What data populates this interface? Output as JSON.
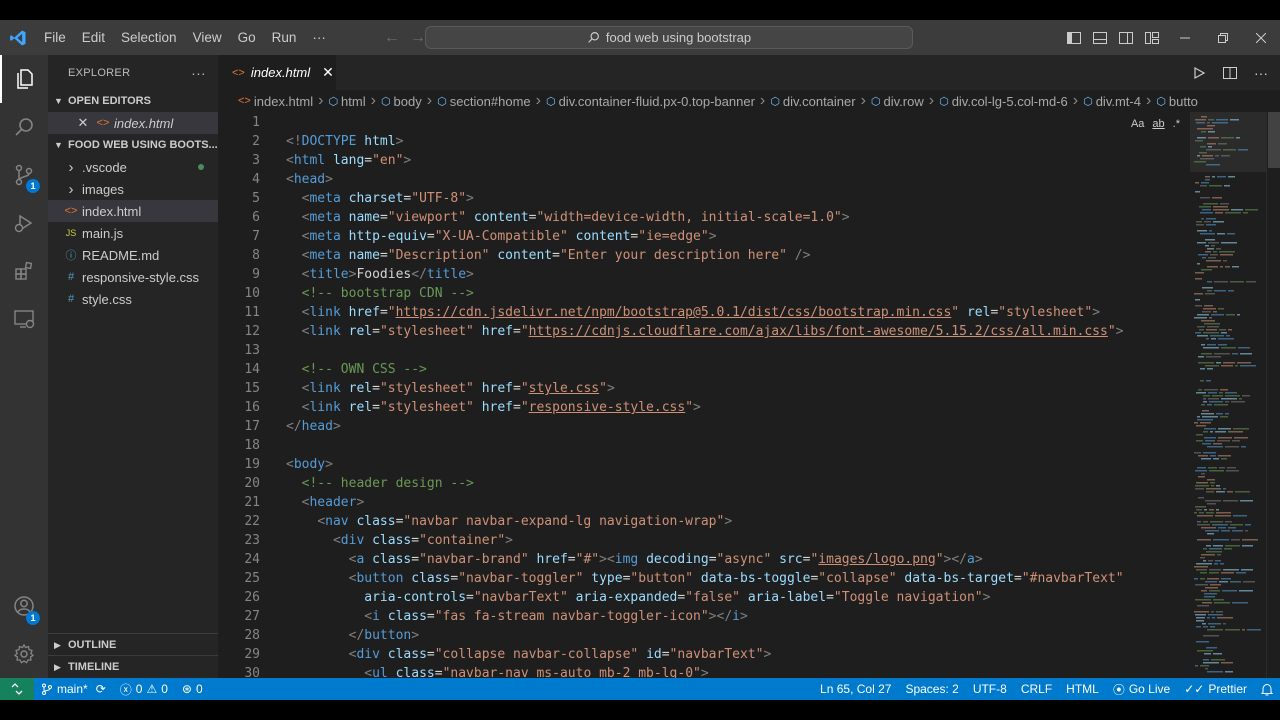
{
  "menu": [
    "File",
    "Edit",
    "Selection",
    "View",
    "Go",
    "Run",
    "···"
  ],
  "search": {
    "text": "food web using bootstrap"
  },
  "explorer": {
    "title": "EXPLORER",
    "more": "···",
    "open_editors_label": "OPEN EDITORS",
    "open_editor_file": "index.html",
    "project_label": "FOOD WEB USING BOOTS...",
    "items": [
      {
        "name": ".vscode",
        "kind": "folder"
      },
      {
        "name": "images",
        "kind": "folder"
      },
      {
        "name": "index.html",
        "kind": "html"
      },
      {
        "name": "main.js",
        "kind": "js"
      },
      {
        "name": "README.md",
        "kind": "md"
      },
      {
        "name": "responsive-style.css",
        "kind": "css"
      },
      {
        "name": "style.css",
        "kind": "css"
      }
    ],
    "outline_label": "OUTLINE",
    "timeline_label": "TIMELINE"
  },
  "tab": {
    "label": "index.html"
  },
  "breadcrumb": [
    "index.html",
    "html",
    "body",
    "section#home",
    "div.container-fluid.px-0.top-banner",
    "div.container",
    "div.row",
    "div.col-lg-5.col-md-6",
    "div.mt-4",
    "butto"
  ],
  "find_widget": {
    "case": "Aa",
    "word": "ab",
    "regex": ".*"
  },
  "badges": {
    "source_control": "1",
    "accounts": "1"
  },
  "code_lines": [
    {
      "n": "1",
      "tokens": []
    },
    {
      "n": "2",
      "tokens": [
        [
          "br",
          "<!"
        ],
        [
          "tag",
          "DOCTYPE"
        ],
        [
          "txt",
          " "
        ],
        [
          "attr",
          "html"
        ],
        [
          "br",
          ">"
        ]
      ]
    },
    {
      "n": "3",
      "tokens": [
        [
          "br",
          "<"
        ],
        [
          "tag",
          "html"
        ],
        [
          "txt",
          " "
        ],
        [
          "attr",
          "lang"
        ],
        [
          "txt",
          "="
        ],
        [
          "str",
          "\"en\""
        ],
        [
          "br",
          ">"
        ]
      ]
    },
    {
      "n": "4",
      "tokens": [
        [
          "br",
          "<"
        ],
        [
          "tag",
          "head"
        ],
        [
          "br",
          ">"
        ]
      ]
    },
    {
      "n": "5",
      "tokens": [
        [
          "txt",
          "  "
        ],
        [
          "br",
          "<"
        ],
        [
          "tag",
          "meta"
        ],
        [
          "txt",
          " "
        ],
        [
          "attr",
          "charset"
        ],
        [
          "txt",
          "="
        ],
        [
          "str",
          "\"UTF-8\""
        ],
        [
          "br",
          ">"
        ]
      ]
    },
    {
      "n": "6",
      "tokens": [
        [
          "txt",
          "  "
        ],
        [
          "br",
          "<"
        ],
        [
          "tag",
          "meta"
        ],
        [
          "txt",
          " "
        ],
        [
          "attr",
          "name"
        ],
        [
          "txt",
          "="
        ],
        [
          "str",
          "\"viewport\""
        ],
        [
          "txt",
          " "
        ],
        [
          "attr",
          "content"
        ],
        [
          "txt",
          "="
        ],
        [
          "str",
          "\"width=device-width, initial-scale=1.0\""
        ],
        [
          "br",
          ">"
        ]
      ]
    },
    {
      "n": "7",
      "tokens": [
        [
          "txt",
          "  "
        ],
        [
          "br",
          "<"
        ],
        [
          "tag",
          "meta"
        ],
        [
          "txt",
          " "
        ],
        [
          "attr",
          "http-equiv"
        ],
        [
          "txt",
          "="
        ],
        [
          "str",
          "\"X-UA-Compatible\""
        ],
        [
          "txt",
          " "
        ],
        [
          "attr",
          "content"
        ],
        [
          "txt",
          "="
        ],
        [
          "str",
          "\"ie=edge\""
        ],
        [
          "br",
          ">"
        ]
      ]
    },
    {
      "n": "8",
      "tokens": [
        [
          "txt",
          "  "
        ],
        [
          "br",
          "<"
        ],
        [
          "tag",
          "meta"
        ],
        [
          "txt",
          " "
        ],
        [
          "attr",
          "name"
        ],
        [
          "txt",
          "="
        ],
        [
          "str",
          "\"Description\""
        ],
        [
          "txt",
          " "
        ],
        [
          "attr",
          "content"
        ],
        [
          "txt",
          "="
        ],
        [
          "str",
          "\"Enter your description here\""
        ],
        [
          "txt",
          " "
        ],
        [
          "br",
          "/>"
        ]
      ]
    },
    {
      "n": "9",
      "tokens": [
        [
          "txt",
          "  "
        ],
        [
          "br",
          "<"
        ],
        [
          "tag",
          "title"
        ],
        [
          "br",
          ">"
        ],
        [
          "txt",
          "Foodies"
        ],
        [
          "br",
          "</"
        ],
        [
          "tag",
          "title"
        ],
        [
          "br",
          ">"
        ]
      ]
    },
    {
      "n": "10",
      "tokens": [
        [
          "txt",
          "  "
        ],
        [
          "com",
          "<!-- bootstrap CDN -->"
        ]
      ]
    },
    {
      "n": "11",
      "tokens": [
        [
          "txt",
          "  "
        ],
        [
          "br",
          "<"
        ],
        [
          "tag",
          "link"
        ],
        [
          "txt",
          " "
        ],
        [
          "attr",
          "href"
        ],
        [
          "txt",
          "="
        ],
        [
          "str",
          "\""
        ],
        [
          "url",
          "https://cdn.jsdelivr.net/npm/bootstrap@5.0.1/dist/css/bootstrap.min.css"
        ],
        [
          "str",
          "\""
        ],
        [
          "txt",
          " "
        ],
        [
          "attr",
          "rel"
        ],
        [
          "txt",
          "="
        ],
        [
          "str",
          "\"stylesheet\""
        ],
        [
          "br",
          ">"
        ]
      ]
    },
    {
      "n": "12",
      "tokens": [
        [
          "txt",
          "  "
        ],
        [
          "br",
          "<"
        ],
        [
          "tag",
          "link"
        ],
        [
          "txt",
          " "
        ],
        [
          "attr",
          "rel"
        ],
        [
          "txt",
          "="
        ],
        [
          "str",
          "\"stylesheet\""
        ],
        [
          "txt",
          " "
        ],
        [
          "attr",
          "href"
        ],
        [
          "txt",
          "="
        ],
        [
          "str",
          "\""
        ],
        [
          "url",
          "https://cdnjs.cloudflare.com/ajax/libs/font-awesome/5.15.2/css/all.min.css"
        ],
        [
          "str",
          "\""
        ],
        [
          "br",
          ">"
        ]
      ]
    },
    {
      "n": "13",
      "tokens": []
    },
    {
      "n": "14",
      "tokens": [
        [
          "txt",
          "  "
        ],
        [
          "com",
          "<!-- OWN CSS -->"
        ]
      ]
    },
    {
      "n": "15",
      "tokens": [
        [
          "txt",
          "  "
        ],
        [
          "br",
          "<"
        ],
        [
          "tag",
          "link"
        ],
        [
          "txt",
          " "
        ],
        [
          "attr",
          "rel"
        ],
        [
          "txt",
          "="
        ],
        [
          "str",
          "\"stylesheet\""
        ],
        [
          "txt",
          " "
        ],
        [
          "attr",
          "href"
        ],
        [
          "txt",
          "="
        ],
        [
          "str",
          "\""
        ],
        [
          "url",
          "style.css"
        ],
        [
          "str",
          "\""
        ],
        [
          "br",
          ">"
        ]
      ]
    },
    {
      "n": "16",
      "tokens": [
        [
          "txt",
          "  "
        ],
        [
          "br",
          "<"
        ],
        [
          "tag",
          "link"
        ],
        [
          "txt",
          " "
        ],
        [
          "attr",
          "rel"
        ],
        [
          "txt",
          "="
        ],
        [
          "str",
          "\"stylesheet\""
        ],
        [
          "txt",
          " "
        ],
        [
          "attr",
          "href"
        ],
        [
          "txt",
          "="
        ],
        [
          "str",
          "\""
        ],
        [
          "url",
          "responsive-style.css"
        ],
        [
          "str",
          "\""
        ],
        [
          "br",
          ">"
        ]
      ]
    },
    {
      "n": "17",
      "tokens": [
        [
          "br",
          "</"
        ],
        [
          "tag",
          "head"
        ],
        [
          "br",
          ">"
        ]
      ]
    },
    {
      "n": "18",
      "tokens": []
    },
    {
      "n": "19",
      "tokens": [
        [
          "br",
          "<"
        ],
        [
          "tag",
          "body"
        ],
        [
          "br",
          ">"
        ]
      ]
    },
    {
      "n": "20",
      "tokens": [
        [
          "txt",
          "  "
        ],
        [
          "com",
          "<!-- header design -->"
        ]
      ]
    },
    {
      "n": "21",
      "tokens": [
        [
          "txt",
          "  "
        ],
        [
          "br",
          "<"
        ],
        [
          "tag",
          "header"
        ],
        [
          "br",
          ">"
        ]
      ]
    },
    {
      "n": "22",
      "tokens": [
        [
          "txt",
          "    "
        ],
        [
          "br",
          "<"
        ],
        [
          "tag",
          "nav"
        ],
        [
          "txt",
          " "
        ],
        [
          "attr",
          "class"
        ],
        [
          "txt",
          "="
        ],
        [
          "str",
          "\"navbar navbar-expand-lg navigation-wrap\""
        ],
        [
          "br",
          ">"
        ]
      ]
    },
    {
      "n": "23",
      "tokens": [
        [
          "txt",
          "      "
        ],
        [
          "br",
          "<"
        ],
        [
          "tag",
          "div"
        ],
        [
          "txt",
          " "
        ],
        [
          "attr",
          "class"
        ],
        [
          "txt",
          "="
        ],
        [
          "str",
          "\"container\""
        ],
        [
          "br",
          ">"
        ]
      ]
    },
    {
      "n": "24",
      "tokens": [
        [
          "txt",
          "        "
        ],
        [
          "br",
          "<"
        ],
        [
          "tag",
          "a"
        ],
        [
          "txt",
          " "
        ],
        [
          "attr",
          "class"
        ],
        [
          "txt",
          "="
        ],
        [
          "str",
          "\"navbar-brand\""
        ],
        [
          "txt",
          " "
        ],
        [
          "attr",
          "href"
        ],
        [
          "txt",
          "="
        ],
        [
          "str",
          "\"#\""
        ],
        [
          "br",
          "><"
        ],
        [
          "tag",
          "img"
        ],
        [
          "txt",
          " "
        ],
        [
          "attr",
          "decoding"
        ],
        [
          "txt",
          "="
        ],
        [
          "str",
          "\"async\""
        ],
        [
          "txt",
          " "
        ],
        [
          "attr",
          "src"
        ],
        [
          "txt",
          "="
        ],
        [
          "str",
          "\""
        ],
        [
          "url",
          "images/logo.png"
        ],
        [
          "str",
          "\""
        ],
        [
          "br",
          "></"
        ],
        [
          "tag",
          "a"
        ],
        [
          "br",
          ">"
        ]
      ]
    },
    {
      "n": "25",
      "tokens": [
        [
          "txt",
          "        "
        ],
        [
          "br",
          "<"
        ],
        [
          "tag",
          "button"
        ],
        [
          "txt",
          " "
        ],
        [
          "attr",
          "class"
        ],
        [
          "txt",
          "="
        ],
        [
          "str",
          "\"navbar-toggler\""
        ],
        [
          "txt",
          " "
        ],
        [
          "attr",
          "type"
        ],
        [
          "txt",
          "="
        ],
        [
          "str",
          "\"button\""
        ],
        [
          "txt",
          " "
        ],
        [
          "attr",
          "data-bs-toggle"
        ],
        [
          "txt",
          "="
        ],
        [
          "str",
          "\"collapse\""
        ],
        [
          "txt",
          " "
        ],
        [
          "attr",
          "data-bs-target"
        ],
        [
          "txt",
          "="
        ],
        [
          "str",
          "\"#navbarText\""
        ]
      ]
    },
    {
      "n": "26",
      "tokens": [
        [
          "txt",
          "          "
        ],
        [
          "attr",
          "aria-controls"
        ],
        [
          "txt",
          "="
        ],
        [
          "str",
          "\"navbarText\""
        ],
        [
          "txt",
          " "
        ],
        [
          "attr",
          "aria-expanded"
        ],
        [
          "txt",
          "="
        ],
        [
          "str",
          "\"false\""
        ],
        [
          "txt",
          " "
        ],
        [
          "attr",
          "aria-label"
        ],
        [
          "txt",
          "="
        ],
        [
          "str",
          "\"Toggle navigation\""
        ],
        [
          "br",
          ">"
        ]
      ]
    },
    {
      "n": "27",
      "tokens": [
        [
          "txt",
          "          "
        ],
        [
          "br",
          "<"
        ],
        [
          "tag",
          "i"
        ],
        [
          "txt",
          " "
        ],
        [
          "attr",
          "class"
        ],
        [
          "txt",
          "="
        ],
        [
          "str",
          "\"fas fa-stream navbar-toggler-icon\""
        ],
        [
          "br",
          "></"
        ],
        [
          "tag",
          "i"
        ],
        [
          "br",
          ">"
        ]
      ]
    },
    {
      "n": "28",
      "tokens": [
        [
          "txt",
          "        "
        ],
        [
          "br",
          "</"
        ],
        [
          "tag",
          "button"
        ],
        [
          "br",
          ">"
        ]
      ]
    },
    {
      "n": "29",
      "tokens": [
        [
          "txt",
          "        "
        ],
        [
          "br",
          "<"
        ],
        [
          "tag",
          "div"
        ],
        [
          "txt",
          " "
        ],
        [
          "attr",
          "class"
        ],
        [
          "txt",
          "="
        ],
        [
          "str",
          "\"collapse navbar-collapse\""
        ],
        [
          "txt",
          " "
        ],
        [
          "attr",
          "id"
        ],
        [
          "txt",
          "="
        ],
        [
          "str",
          "\"navbarText\""
        ],
        [
          "br",
          ">"
        ]
      ]
    },
    {
      "n": "30",
      "tokens": [
        [
          "txt",
          "          "
        ],
        [
          "br",
          "<"
        ],
        [
          "tag",
          "ul"
        ],
        [
          "txt",
          " "
        ],
        [
          "attr",
          "class"
        ],
        [
          "txt",
          "="
        ],
        [
          "str",
          "\"navbar-nav ms-auto mb-2 mb-lg-0\""
        ],
        [
          "br",
          ">"
        ]
      ]
    }
  ],
  "status": {
    "branch": "main*",
    "errors": "0",
    "warnings": "0",
    "ports": "0",
    "position": "Ln 65, Col 27",
    "spaces": "Spaces: 2",
    "encoding": "UTF-8",
    "eol": "CRLF",
    "language": "HTML",
    "golive": "Go Live",
    "prettier": "Prettier"
  },
  "colors": {
    "statusbar": "#007acc",
    "remote": "#16825d",
    "accent": "#0078d4"
  }
}
